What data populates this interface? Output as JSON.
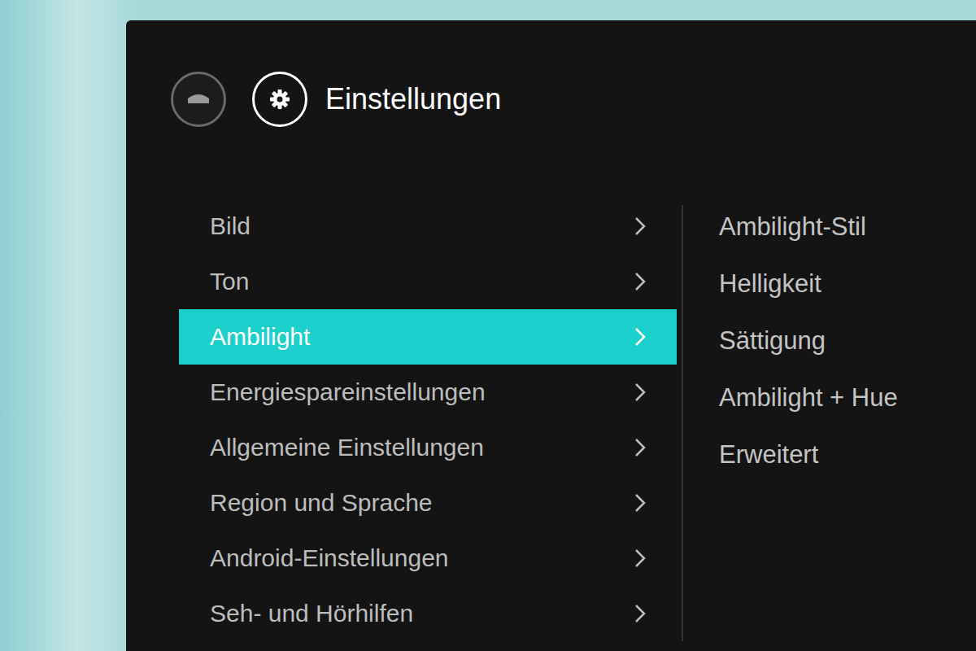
{
  "window": {
    "title": "Einstellungen"
  },
  "menu": [
    {
      "label": "Bild",
      "selected": false
    },
    {
      "label": "Ton",
      "selected": false
    },
    {
      "label": "Ambilight",
      "selected": true
    },
    {
      "label": "Energiespareinstellungen",
      "selected": false
    },
    {
      "label": "Allgemeine Einstellungen",
      "selected": false
    },
    {
      "label": "Region und Sprache",
      "selected": false
    },
    {
      "label": "Android-Einstellungen",
      "selected": false
    },
    {
      "label": "Seh- und Hörhilfen",
      "selected": false
    }
  ],
  "submenu": [
    {
      "label": "Ambilight-Stil"
    },
    {
      "label": "Helligkeit"
    },
    {
      "label": "Sättigung"
    },
    {
      "label": "Ambilight + Hue"
    },
    {
      "label": "Erweitert"
    }
  ]
}
